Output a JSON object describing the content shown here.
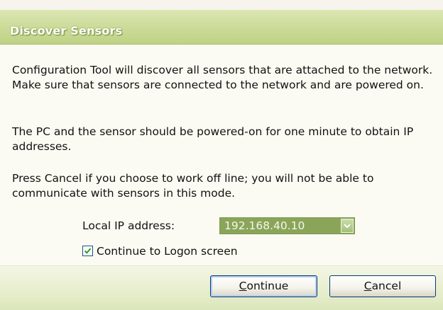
{
  "dialog": {
    "title": "Discover Sensors",
    "paragraphs": [
      "Configuration Tool will discover all sensors that are attached to the network. Make sure that sensors are connected to the network and are powered on.",
      "The PC and the sensor should be powered-on for one minute to obtain IP addresses.",
      "Press Cancel if you choose to work off line; you will not be able to communicate with sensors in this mode."
    ],
    "ip_label": "Local IP address:",
    "ip_value": "192.168.40.10",
    "checkbox": {
      "label": "Continue to Logon screen",
      "checked": true
    },
    "buttons": {
      "continue": {
        "accel": "C",
        "rest": "ontinue"
      },
      "cancel": {
        "accel": "C",
        "rest": "ancel"
      }
    }
  },
  "colors": {
    "title_bar": "#cbdb97",
    "footer": "#e4ecc8",
    "button_border": "#003c74"
  },
  "icons": {
    "dropdown": "chevron-down-icon",
    "check": "checkmark-icon"
  }
}
